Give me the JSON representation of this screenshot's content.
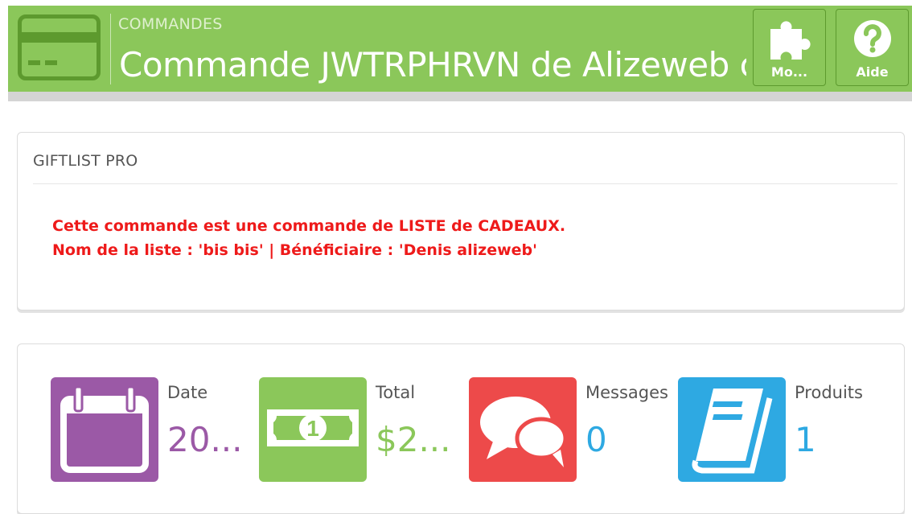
{
  "header": {
    "breadcrumb": "COMMANDES",
    "title": "Commande JWTRPHRVN de Alizeweb contact",
    "buttons": [
      {
        "label": "Mo...",
        "icon": "puzzle-icon"
      },
      {
        "label": "Aide",
        "icon": "help-icon"
      }
    ]
  },
  "gift_panel": {
    "heading": "GIFTLIST PRO",
    "line1": "Cette commande est une commande de LISTE de CADEAUX.",
    "line2": "Nom de la liste : 'bis bis' | Bénéficiaire : 'Denis alizeweb'"
  },
  "stats": [
    {
      "label": "Date",
      "value": "20...",
      "icon": "calendar-icon",
      "color": "#9b59a6"
    },
    {
      "label": "Total",
      "value": "$2...",
      "icon": "money-icon",
      "color": "#8bc75a"
    },
    {
      "label": "Messages",
      "value": "0",
      "icon": "chat-bubbles-icon",
      "color": "#ed4a4a"
    },
    {
      "label": "Produits",
      "value": "1",
      "icon": "book-icon",
      "color": "#2ea9e2"
    }
  ],
  "colors": {
    "header_green": "#8bc75a",
    "header_dark_green": "#5d9a2e",
    "alert_red": "#ee1a1a"
  }
}
